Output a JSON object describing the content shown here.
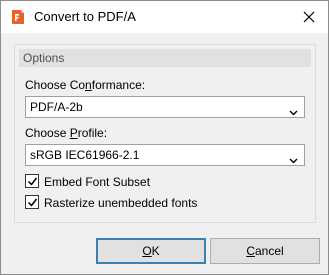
{
  "window": {
    "title": "Convert to PDF/A",
    "app_icon": "foxit-pdf-icon",
    "close_icon": "close-icon"
  },
  "options_group": {
    "header": "Options",
    "conformance": {
      "label_pre": "Choose Co",
      "label_accel": "n",
      "label_post": "formance:",
      "value": "PDF/A-2b"
    },
    "profile": {
      "label_pre": "Choose ",
      "label_accel": "P",
      "label_post": "rofile:",
      "value": "sRGB IEC61966-2.1"
    },
    "embed_font_subset": {
      "label": "Embed Font Subset",
      "checked": true
    },
    "rasterize_unembedded": {
      "label": "Rasterize unembedded fonts",
      "checked": true
    }
  },
  "buttons": {
    "ok": {
      "accel": "O",
      "rest": "K"
    },
    "cancel": {
      "accel": "C",
      "rest": "ancel"
    }
  },
  "colors": {
    "accent_orange": "#e8622a",
    "default_button_border": "#3c7fb1"
  }
}
